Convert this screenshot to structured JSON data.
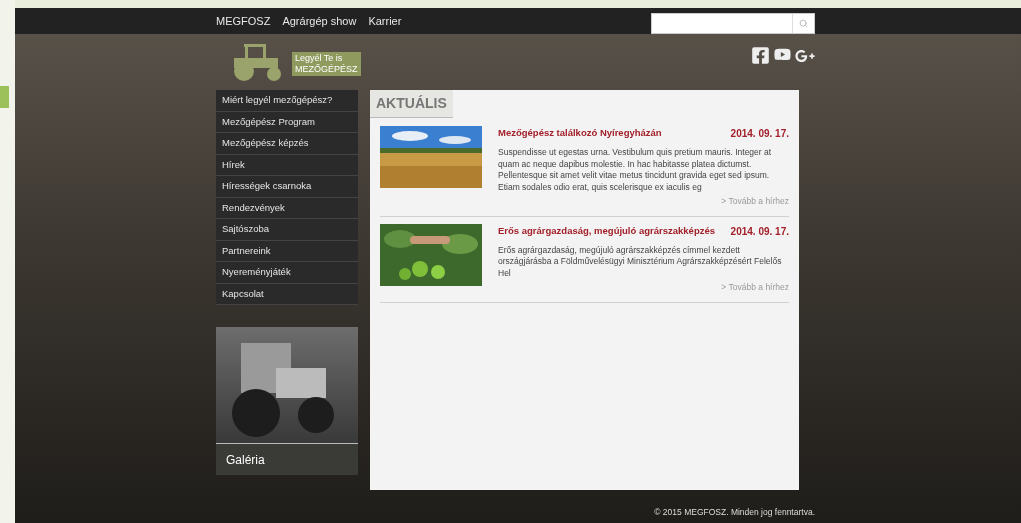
{
  "top_nav": {
    "links": [
      "MEGFOSZ",
      "Agrárgép show",
      "Karrier"
    ]
  },
  "logo": {
    "lines": [
      "Legyél Te is",
      "MEZŐGÉPÉSZ"
    ]
  },
  "sidebar": {
    "items": [
      {
        "label": "Miért legyél mezőgépész?"
      },
      {
        "label": "Mezőgépész Program"
      },
      {
        "label": "Mezőgépész képzés"
      },
      {
        "label": "Hírek"
      },
      {
        "label": "Hírességek csarnoka"
      },
      {
        "label": "Rendezvények"
      },
      {
        "label": "Sajtószoba"
      },
      {
        "label": "Partnereink"
      },
      {
        "label": "Nyereményjáték"
      },
      {
        "label": "Kapcsolat"
      }
    ]
  },
  "gallery": {
    "label": "Galéria"
  },
  "news": {
    "title": "AKTUÁLIS",
    "items": [
      {
        "kind": "field",
        "headline": "Mezőgépész találkozó Nyíregyházán",
        "date": "2014. 09. 17.",
        "excerpt": "Suspendisse ut egestas urna. Vestibulum quis pretium mauris. Integer at quam ac neque dapibus molestie. In hac habitasse platea dictumst. Pellentesque sit amet velit vitae metus tincidunt gravida eget sed ipsum. Etiam sodales odio erat, quis scelerisque ex iaculis eg",
        "more": "> Tovább a hírhez"
      },
      {
        "kind": "plants",
        "headline": "Erős agrárgazdaság, megújuló agrárszakképzés",
        "date": "2014. 09. 17.",
        "excerpt": "Erős agrárgazdaság, megújuló agrárszakképzés címmel kezdett országjárásba a Földművelésügyi Minisztérium Agrárszakképzésért Felelős Hel",
        "more": "> Tovább a hírhez"
      }
    ]
  },
  "footer": {
    "copyright": "© 2015 MEGFOSZ. Minden jog fenntartva."
  }
}
